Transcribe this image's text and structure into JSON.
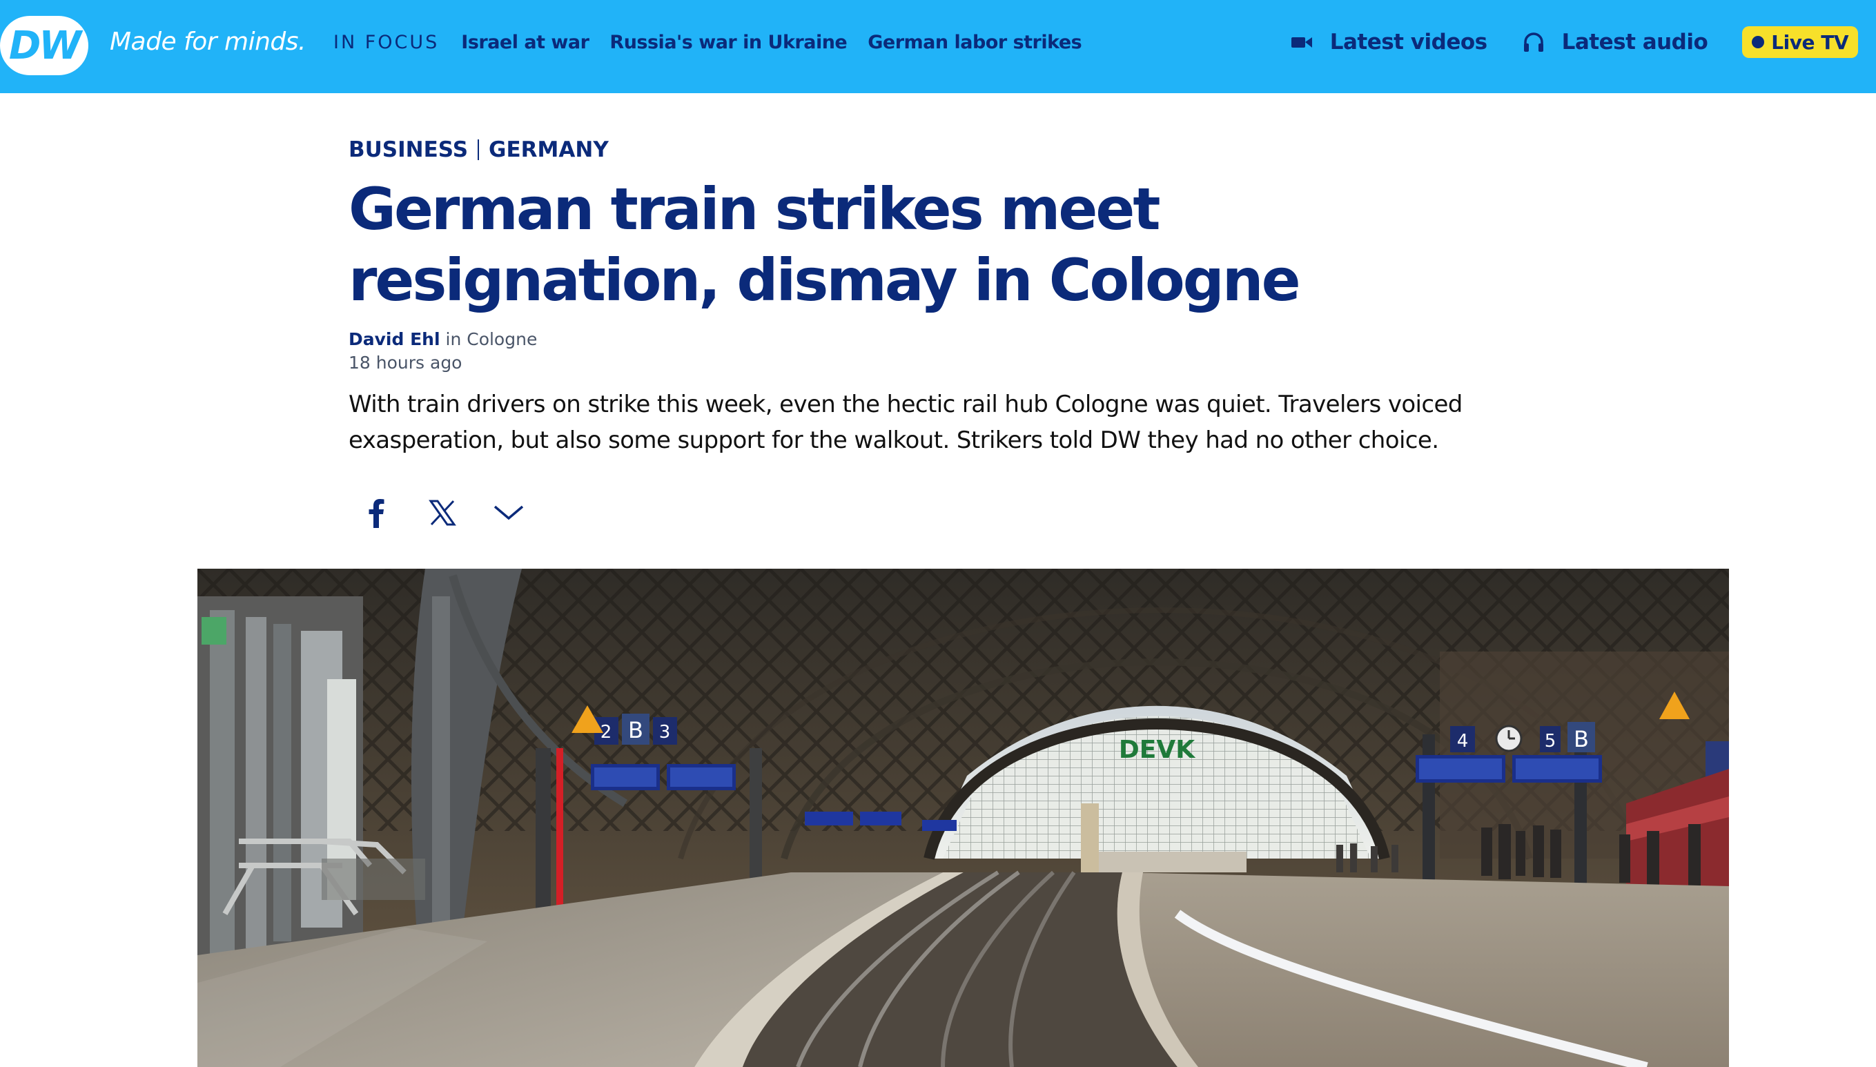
{
  "header": {
    "logo_text": "DW",
    "tagline": "Made for minds.",
    "in_focus_label": "IN FOCUS",
    "focus_links": [
      "Israel at war",
      "Russia's war in Ukraine",
      "German labor strikes"
    ],
    "latest_videos": "Latest videos",
    "latest_audio": "Latest audio",
    "live_tv": "Live TV",
    "colors": {
      "bar": "#21b3f8",
      "text": "#0b2a7a",
      "live_badge": "#f7e02a"
    }
  },
  "article": {
    "categories": [
      "BUSINESS",
      "GERMANY"
    ],
    "headline": "German train strikes meet resignation, dismay in Cologne",
    "author": "David Ehl",
    "location": "in Cologne",
    "time": "18 hours ago",
    "teaser": "With train drivers on strike this week, even the hectic rail hub Cologne was quiet. Travelers voiced exasperation, but also some support for the walkout. Strikers told DW they had no other choice."
  },
  "share": {
    "icons": [
      "facebook-icon",
      "x-icon",
      "chevron-down-icon"
    ]
  },
  "hero_image": {
    "sign_text": "DEVK",
    "platform_labels": [
      "2",
      "B",
      "3",
      "4",
      "5",
      "B"
    ]
  }
}
